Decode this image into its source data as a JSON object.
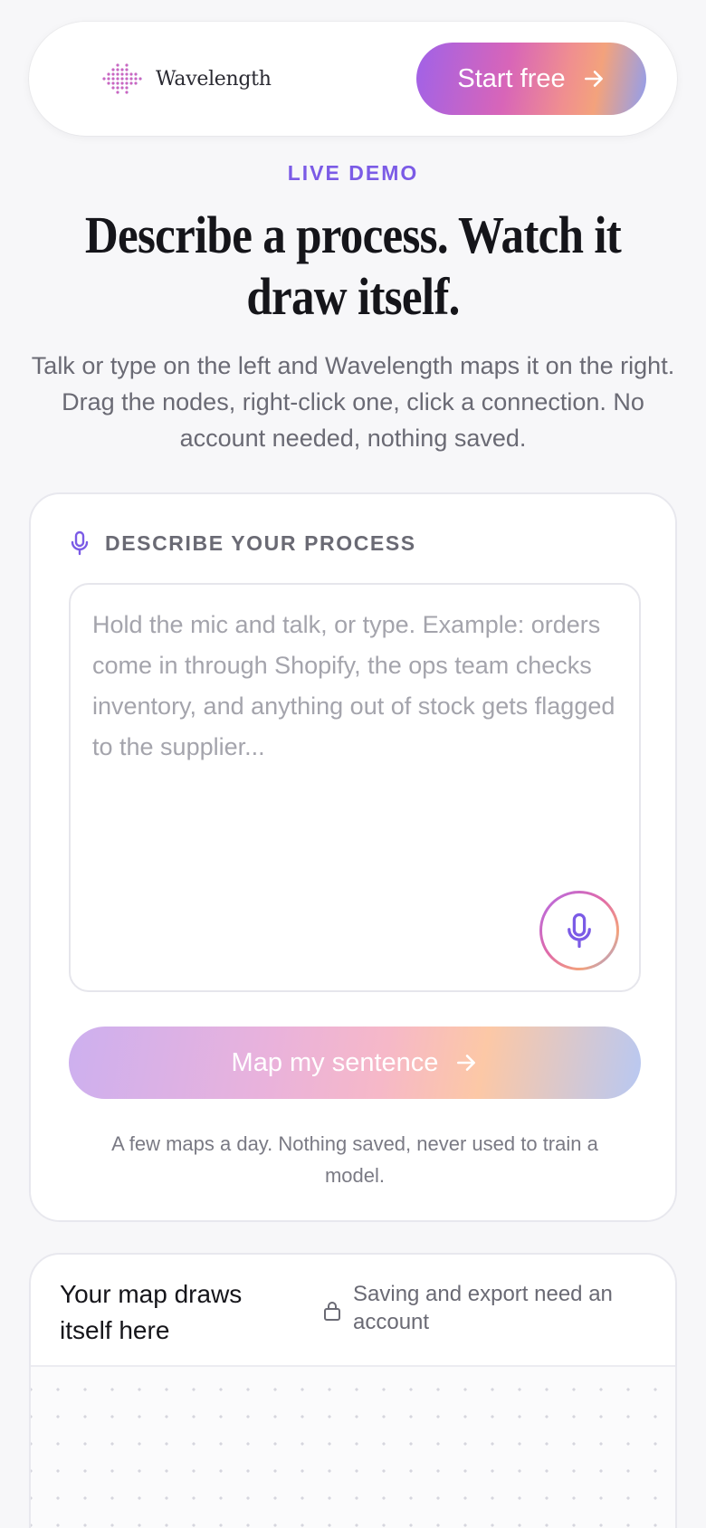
{
  "header": {
    "brand_name": "Wavelength",
    "cta_label": "Start free",
    "logo_icon": "wave-dots-icon",
    "cta_icon": "arrow-right-icon"
  },
  "hero": {
    "eyebrow": "LIVE DEMO",
    "title": "Describe a process. Watch it draw itself.",
    "subtitle": "Talk or type on the left and Wavelength maps it on the right. Drag the nodes, right-click one, click a connection. No account needed, nothing saved."
  },
  "input_card": {
    "label": "DESCRIBE YOUR PROCESS",
    "label_icon": "microphone-icon",
    "placeholder": "Hold the mic and talk, or type. Example: orders come in through Shopify, the ops team checks inventory, and anything out of stock gets flagged to the supplier...",
    "value": "",
    "mic_button_icon": "microphone-icon",
    "submit_label": "Map my sentence",
    "submit_icon": "arrow-right-icon",
    "note": "A few maps a day. Nothing saved, never used to train a model."
  },
  "map_card": {
    "title": "Your map draws itself here",
    "lock_note": "Saving and export need an account",
    "lock_icon": "lock-icon"
  },
  "colors": {
    "accent": "#7b5be6",
    "gradient_start": "#a062e8",
    "gradient_mid": "#d865b8",
    "gradient_warm": "#f3a27c",
    "gradient_end": "#8f9ef0",
    "background": "#f7f7f9",
    "muted_text": "#6a6a74"
  }
}
